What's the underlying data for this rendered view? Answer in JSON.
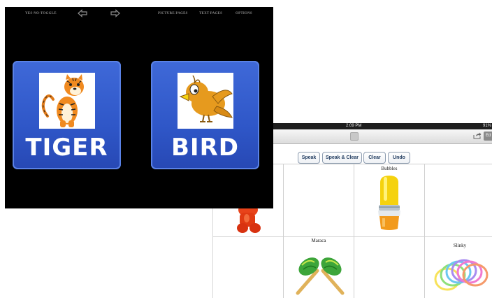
{
  "front_screen": {
    "menu": {
      "title": "YES-NO-TOGGLE",
      "picture_pages": "PICTURE PAGES",
      "text_pages": "TEXT PAGES",
      "options": "OPTIONS"
    },
    "icons": {
      "back": "left-arrow-icon",
      "forward": "right-arrow-icon"
    },
    "cards": [
      {
        "word": "TIGER",
        "icon": "tiger-icon"
      },
      {
        "word": "BIRD",
        "icon": "bird-icon"
      }
    ],
    "colors": {
      "background": "#000000",
      "card": "#3059c9",
      "card_text": "#ffffff"
    }
  },
  "board_screen": {
    "status": {
      "time": "2:09 PM",
      "battery": "91%"
    },
    "nav": {
      "edit_label": "Ed"
    },
    "toolbar": {
      "speak": "Speak",
      "speak_clear": "Speak & Clear",
      "clear": "Clear",
      "undo": "Undo"
    },
    "cells": {
      "bubbles": "Bubbles",
      "maraca": "Maraca",
      "slinky": "Slinky"
    }
  }
}
